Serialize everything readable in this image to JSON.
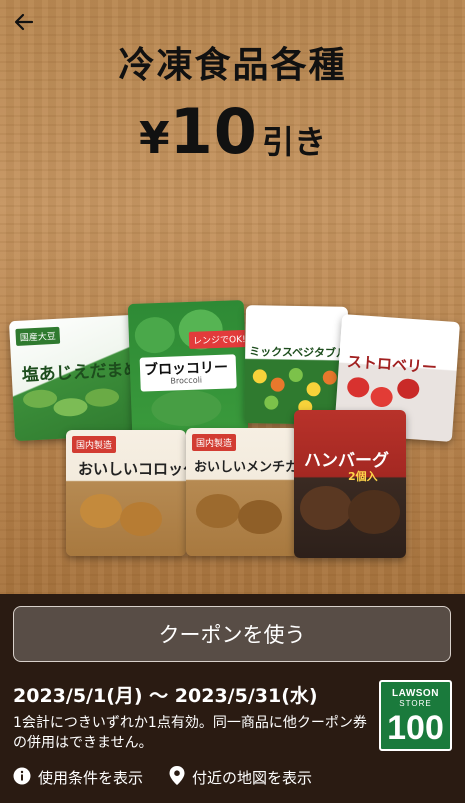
{
  "header": {
    "title": "冷凍食品各種",
    "price_symbol": "¥",
    "price_amount": "10",
    "price_suffix": "引き"
  },
  "products": [
    {
      "name": "塩あじえだまめ",
      "tag": "国産大豆"
    },
    {
      "name": "ブロッコリー",
      "subname": "Broccoli",
      "tag": "レンジでOK!"
    },
    {
      "name": "ミックスベジタブル"
    },
    {
      "name": "ストロベリー"
    },
    {
      "name": "おいしいコロッケ"
    },
    {
      "name": "おいしいメンチカツ"
    },
    {
      "name": "ハンバーグ",
      "subname": "2個入"
    }
  ],
  "coupon": {
    "use_button_label": "クーポンを使う",
    "period": "2023/5/1(月) 〜 2023/5/31(水)",
    "note": "1会計につきいずれか1点有効。同一商品に他クーポン券の併用はできません。"
  },
  "store_logo": {
    "line1": "LAWSON",
    "line2": "STORE",
    "line3": "100",
    "color": "#1a7a3c"
  },
  "footer_links": [
    {
      "label": "使用条件を表示",
      "icon": "info-icon"
    },
    {
      "label": "付近の地図を表示",
      "icon": "map-pin-icon"
    }
  ]
}
